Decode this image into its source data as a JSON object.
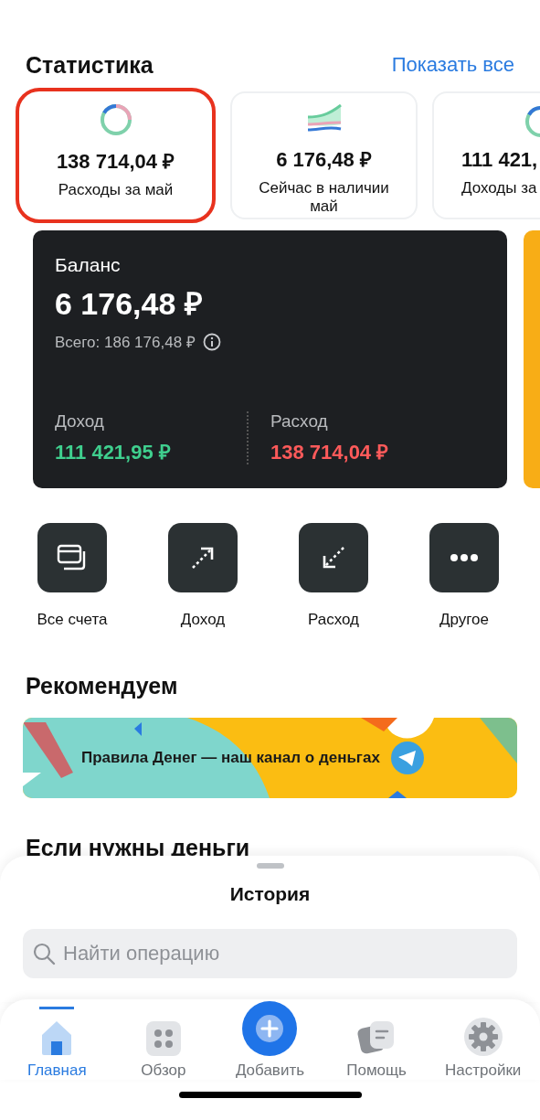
{
  "statistics": {
    "title": "Статистика",
    "show_all": "Показать все",
    "cards": [
      {
        "kind": "donut",
        "amount": "138 714,04 ₽",
        "label": "Расходы за май",
        "highlighted": true
      },
      {
        "kind": "wave",
        "amount": "6 176,48 ₽",
        "label": "Сейчас в наличии май",
        "highlighted": false
      },
      {
        "kind": "donut",
        "amount": "111 421,",
        "label": "Доходы за",
        "highlighted": false
      }
    ]
  },
  "balance": {
    "title": "Баланс",
    "amount": "6 176,48 ₽",
    "total": "Всего: 186 176,48 ₽",
    "income_label": "Доход",
    "income": "111 421,95 ₽",
    "expense_label": "Расход",
    "expense": "138 714,04 ₽"
  },
  "actions": [
    {
      "kind": "accounts",
      "label": "Все счета"
    },
    {
      "kind": "income",
      "label": "Доход"
    },
    {
      "kind": "expense",
      "label": "Расход"
    },
    {
      "kind": "more",
      "label": "Другое"
    }
  ],
  "recommend": {
    "title": "Рекомендуем",
    "banner": "Правила Денег — наш канал о деньгах"
  },
  "need_money": {
    "title": "Если нужны деньги"
  },
  "history": {
    "title": "История",
    "search": {
      "placeholder": "Найти операцию"
    }
  },
  "tabs": [
    {
      "kind": "home",
      "label": "Главная",
      "selected": true
    },
    {
      "kind": "overview",
      "label": "Обзор",
      "selected": false
    },
    {
      "kind": "add",
      "label": "Добавить",
      "selected": false
    },
    {
      "kind": "help",
      "label": "Помощь",
      "selected": false
    },
    {
      "kind": "settings",
      "label": "Настройки",
      "selected": false
    }
  ]
}
